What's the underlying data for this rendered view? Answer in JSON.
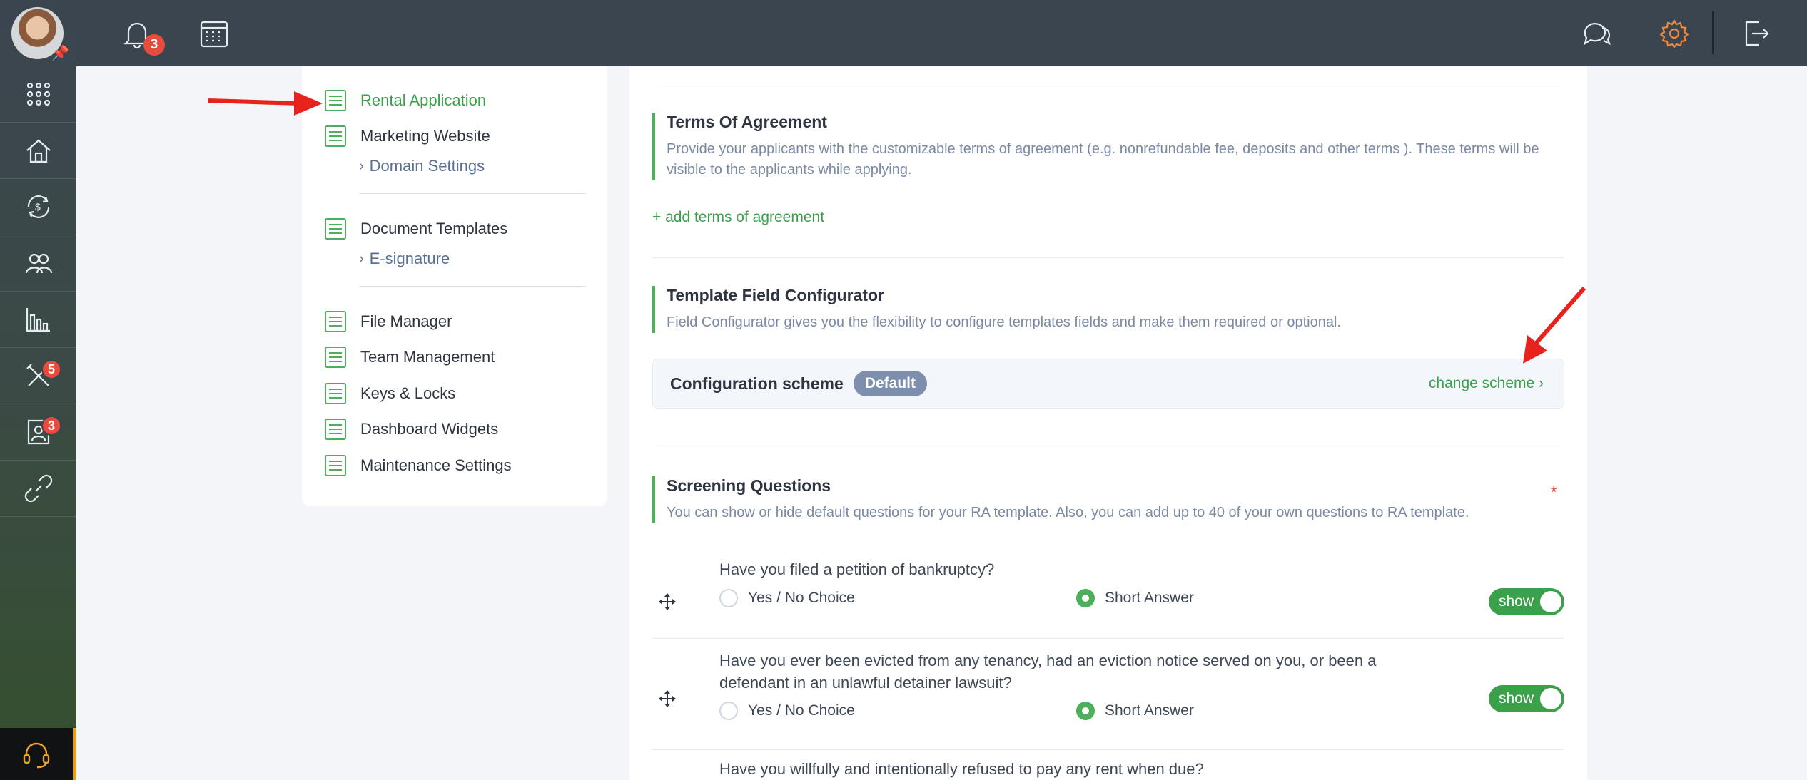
{
  "topbar": {
    "notifications_count": "3"
  },
  "sidebar": {
    "tools_badge": "5",
    "contacts_badge": "3"
  },
  "settings_nav": {
    "rental_application": "Rental Application",
    "marketing_website": "Marketing Website",
    "domain_settings": "Domain Settings",
    "document_templates": "Document Templates",
    "e_signature": "E-signature",
    "file_manager": "File Manager",
    "team_management": "Team Management",
    "keys_locks": "Keys & Locks",
    "dashboard_widgets": "Dashboard Widgets",
    "maintenance_settings": "Maintenance Settings"
  },
  "terms": {
    "title": "Terms Of Agreement",
    "description": "Provide your applicants with the customizable terms of agreement (e.g. nonrefundable fee, deposits and other terms ). These terms will be visible to the applicants while applying.",
    "add_link": "+ add terms of agreement"
  },
  "configurator": {
    "title": "Template Field Configurator",
    "description": "Field Configurator gives you the flexibility to configure templates fields and make them required or optional.",
    "scheme_label": "Configuration scheme",
    "scheme_value": "Default",
    "change_link": "change scheme ›"
  },
  "screening": {
    "title": "Screening Questions",
    "description": "You can show or hide default questions for your RA template. Also, you can add up to 40 of your own questions to RA template.",
    "required_mark": "*",
    "option_yes_no": "Yes / No Choice",
    "option_short": "Short Answer",
    "toggle_label": "show",
    "questions": [
      "Have you filed a petition of bankruptcy?",
      "Have you ever been evicted from any tenancy, had an eviction notice served on you, or been a defendant in an unlawful detainer lawsuit?",
      "Have you willfully and intentionally refused to pay any rent when due?"
    ]
  },
  "colors": {
    "accent": "#3aa14a",
    "topbar": "#3b4550",
    "badge": "#e74c3c"
  }
}
